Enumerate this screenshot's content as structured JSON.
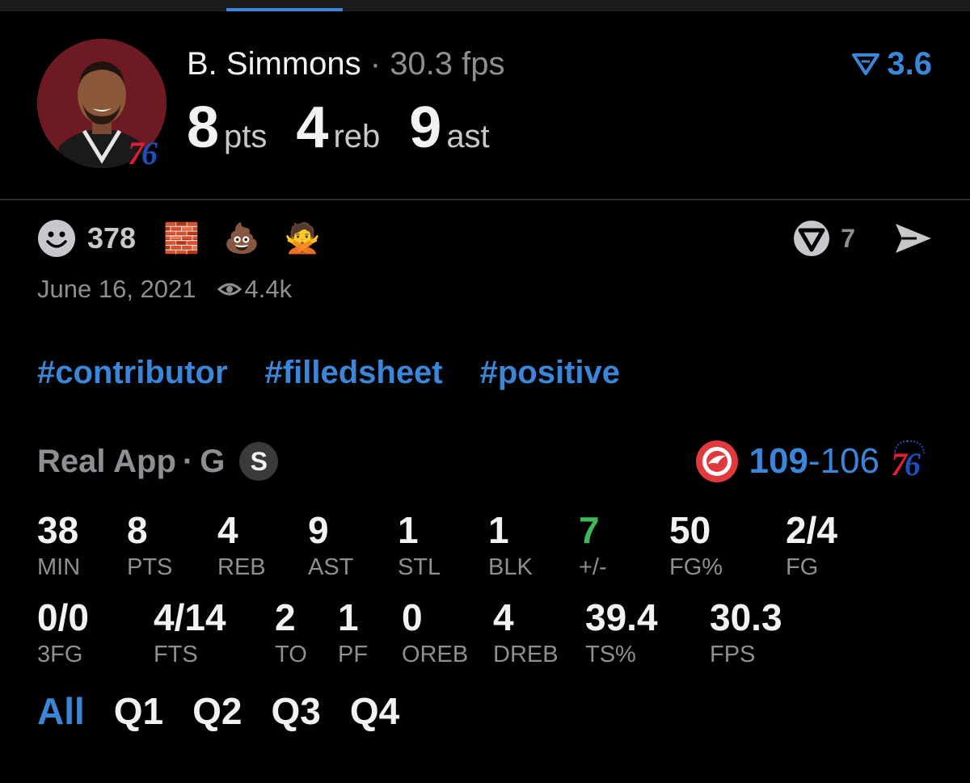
{
  "player": {
    "name": "B. Simmons",
    "separator": "·",
    "fps": "30.3 fps",
    "team_logo": "76",
    "rating": "3.6",
    "rating_icon": "rating-trend-icon"
  },
  "headline": [
    {
      "value": "8",
      "unit": "pts"
    },
    {
      "value": "4",
      "unit": "reb"
    },
    {
      "value": "9",
      "unit": "ast"
    }
  ],
  "reactions": {
    "count": "378",
    "emojis": [
      "🧱",
      "💩",
      "🙅"
    ],
    "comments": "7"
  },
  "meta": {
    "date": "June 16, 2021",
    "views": "4.4k"
  },
  "tags": [
    "#contributor",
    "#filledsheet",
    "#positive"
  ],
  "game": {
    "app": "Real App",
    "dot": "·",
    "position": "G",
    "badge": "S",
    "score": {
      "prefix": "109",
      "suffix": "-106"
    },
    "home_logo": "76"
  },
  "stats_row1": [
    {
      "value": "38",
      "label": "MIN"
    },
    {
      "value": "8",
      "label": "PTS"
    },
    {
      "value": "4",
      "label": "REB"
    },
    {
      "value": "9",
      "label": "AST"
    },
    {
      "value": "1",
      "label": "STL"
    },
    {
      "value": "1",
      "label": "BLK"
    },
    {
      "value": "7",
      "label": "+/-"
    },
    {
      "value": "50",
      "label": "FG%"
    },
    {
      "value": "2/4",
      "label": "FG"
    }
  ],
  "stats_row2": [
    {
      "value": "0/0",
      "label": "3FG"
    },
    {
      "value": "4/14",
      "label": "FTS"
    },
    {
      "value": "2",
      "label": "TO"
    },
    {
      "value": "1",
      "label": "PF"
    },
    {
      "value": "0",
      "label": "OREB"
    },
    {
      "value": "4",
      "label": "DREB"
    },
    {
      "value": "39.4",
      "label": "TS%"
    },
    {
      "value": "30.3",
      "label": "FPS"
    }
  ],
  "quarters": [
    "All",
    "Q1",
    "Q2",
    "Q3",
    "Q4"
  ],
  "colors": {
    "accent": "#3a86d9",
    "positive": "#3fb85c",
    "muted": "#8e8e93"
  }
}
